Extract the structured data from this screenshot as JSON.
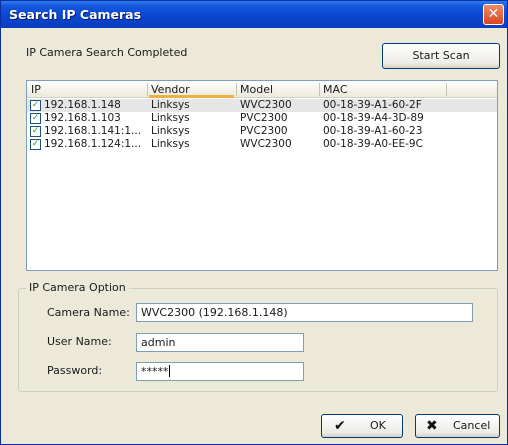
{
  "window": {
    "title": "Search IP Cameras",
    "close_glyph": "✕"
  },
  "status_text": "IP Camera Search Completed",
  "scan_button": {
    "label": "Start Scan"
  },
  "list": {
    "columns": [
      "IP",
      "Vendor",
      "Model",
      "MAC"
    ],
    "rows": [
      {
        "checked": true,
        "ip": "192.168.1.148",
        "vendor": "Linksys",
        "model": "WVC2300",
        "mac": "00-18-39-A1-60-2F"
      },
      {
        "checked": true,
        "ip": "192.168.1.103",
        "vendor": "Linksys",
        "model": "PVC2300",
        "mac": "00-18-39-A4-3D-89"
      },
      {
        "checked": true,
        "ip": "192.168.1.141:1...",
        "vendor": "Linksys",
        "model": "PVC2300",
        "mac": "00-18-39-A1-60-23"
      },
      {
        "checked": true,
        "ip": "192.168.1.124:1...",
        "vendor": "Linksys",
        "model": "WVC2300",
        "mac": "00-18-39-A0-EE-9C"
      }
    ],
    "selected_row": 0
  },
  "option_group": {
    "label": "IP Camera Option",
    "camera_name_label": "Camera Name:",
    "camera_name_value": "WVC2300 (192.168.1.148)",
    "user_name_label": "User Name:",
    "user_name_value": "admin",
    "password_label": "Password:",
    "password_value": "*****"
  },
  "ok_button": {
    "label": "OK",
    "icon": "check-icon",
    "glyph": "✔"
  },
  "cancel_button": {
    "label": "Cancel",
    "icon": "x-icon",
    "glyph": "✖"
  },
  "colors": {
    "title_bar": "#0a47d1",
    "window_bg": "#ece9d8",
    "close_button": "#d9461f",
    "sort_indicator": "#f0b040"
  }
}
